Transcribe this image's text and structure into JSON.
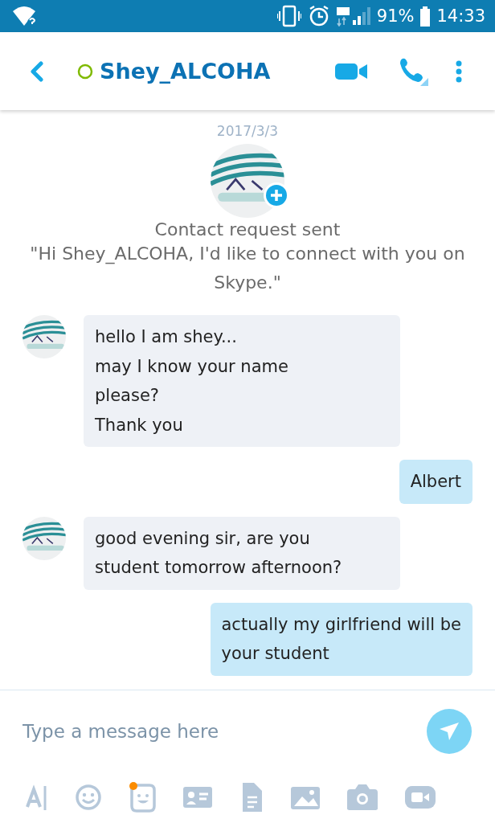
{
  "status_bar": {
    "battery": "91%",
    "time": "14:33"
  },
  "header": {
    "contact_name": "Shey_ALCOHA"
  },
  "date": "2017/3/3",
  "contact_request": {
    "title": "Contact request sent",
    "message": "\"Hi Shey_ALCOHA, I'd like to connect with you on Skype.\""
  },
  "messages": [
    {
      "kind": "incoming",
      "text": "hello I am shey...\nmay I know your name\nplease?\nThank you"
    },
    {
      "kind": "outgoing",
      "text": "Albert"
    },
    {
      "kind": "incoming",
      "text": "good evening sir, are you\nstudent tomorrow afternoon?"
    },
    {
      "kind": "outgoing",
      "text": "actually my girlfriend will be\nyour student"
    }
  ],
  "composer": {
    "placeholder": "Type a message here"
  }
}
